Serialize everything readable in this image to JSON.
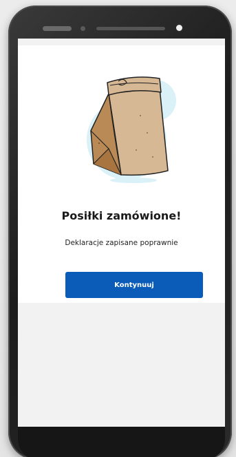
{
  "screen": {
    "title": "Posiłki zamówione!",
    "subtitle": "Deklaracje zapisane poprawnie",
    "illustration": "paper-bag-illustration",
    "continue_label": "Kontynuuj"
  },
  "colors": {
    "button": "#0b5bb8",
    "button_text": "#ffffff",
    "bag": "#d7b894",
    "bag_shadow": "#b98a55",
    "bag_backdrop": "#d9f1f7"
  }
}
